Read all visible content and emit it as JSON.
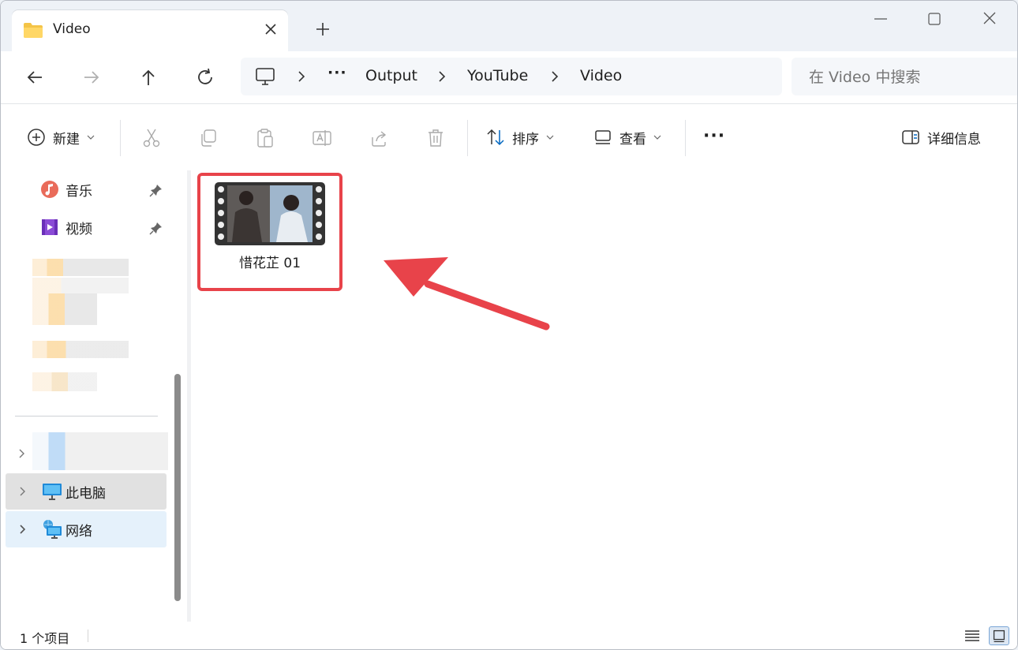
{
  "window": {
    "tab_title": "Video",
    "new_tab_label": "+"
  },
  "nav": {
    "breadcrumbs": [
      "Output",
      "YouTube",
      "Video"
    ],
    "more_crumbs": "···",
    "search_placeholder": "在 Video 中搜索"
  },
  "toolbar": {
    "new_label": "新建",
    "sort_label": "排序",
    "view_label": "查看",
    "more_label": "···",
    "details_label": "详细信息"
  },
  "sidebar": {
    "items": [
      {
        "label": "音乐",
        "icon": "music-icon"
      },
      {
        "label": "视频",
        "icon": "video-library-icon"
      },
      {
        "label": "此电脑",
        "icon": "this-pc-icon"
      },
      {
        "label": "网络",
        "icon": "network-icon"
      }
    ]
  },
  "content": {
    "files": [
      {
        "name": "惜花芷 01",
        "type": "video"
      }
    ]
  },
  "statusbar": {
    "item_count": "1 个项目"
  },
  "colors": {
    "highlight_border": "#e8434a",
    "arrow": "#e8434a",
    "accent": "#0067c0",
    "selected_bg": "#e1e1e1",
    "hover_bg": "#e5f1fb"
  }
}
